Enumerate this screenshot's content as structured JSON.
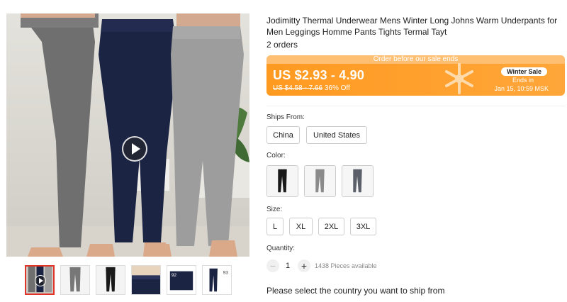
{
  "product": {
    "title": "Jodimitty Thermal Underwear Mens Winter Long Johns Warm Underpants for Men Leggings Homme Pants Tights Termal Tayt",
    "orders": "2 orders"
  },
  "gallery": {
    "main_image": "three men wearing long johns in grey, navy and light grey",
    "thumbnails": [
      "video-thumb",
      "grey-pants",
      "black-pants",
      "waistband-closeup",
      "navy-pants-tag",
      "navy-pants-size"
    ],
    "thumb_labels": {
      "t5": "92",
      "t6": "93"
    }
  },
  "sale": {
    "banner_top": "Order before our sale ends",
    "price": "US $2.93 - 4.90",
    "old_price": "US $4.58 - 7.66",
    "discount": "36% Off",
    "badge": "Winter Sale",
    "ends_in": "Ends in",
    "end_date": "Jan 15, 10:59 MSK"
  },
  "ships_from": {
    "label": "Ships From:",
    "options": [
      "China",
      "United States"
    ]
  },
  "color": {
    "label": "Color:",
    "options": [
      "black",
      "grey",
      "dark-grey"
    ]
  },
  "size": {
    "label": "Size:",
    "options": [
      "L",
      "XL",
      "2XL",
      "3XL"
    ]
  },
  "quantity": {
    "label": "Quantity:",
    "minus": "−",
    "value": "1",
    "plus": "+",
    "available": "1438 Pieces available"
  },
  "shipping_message": "Please select the country you want to ship from",
  "colors": {
    "accent": "#ff9a20",
    "selected_border": "#e0342a"
  }
}
